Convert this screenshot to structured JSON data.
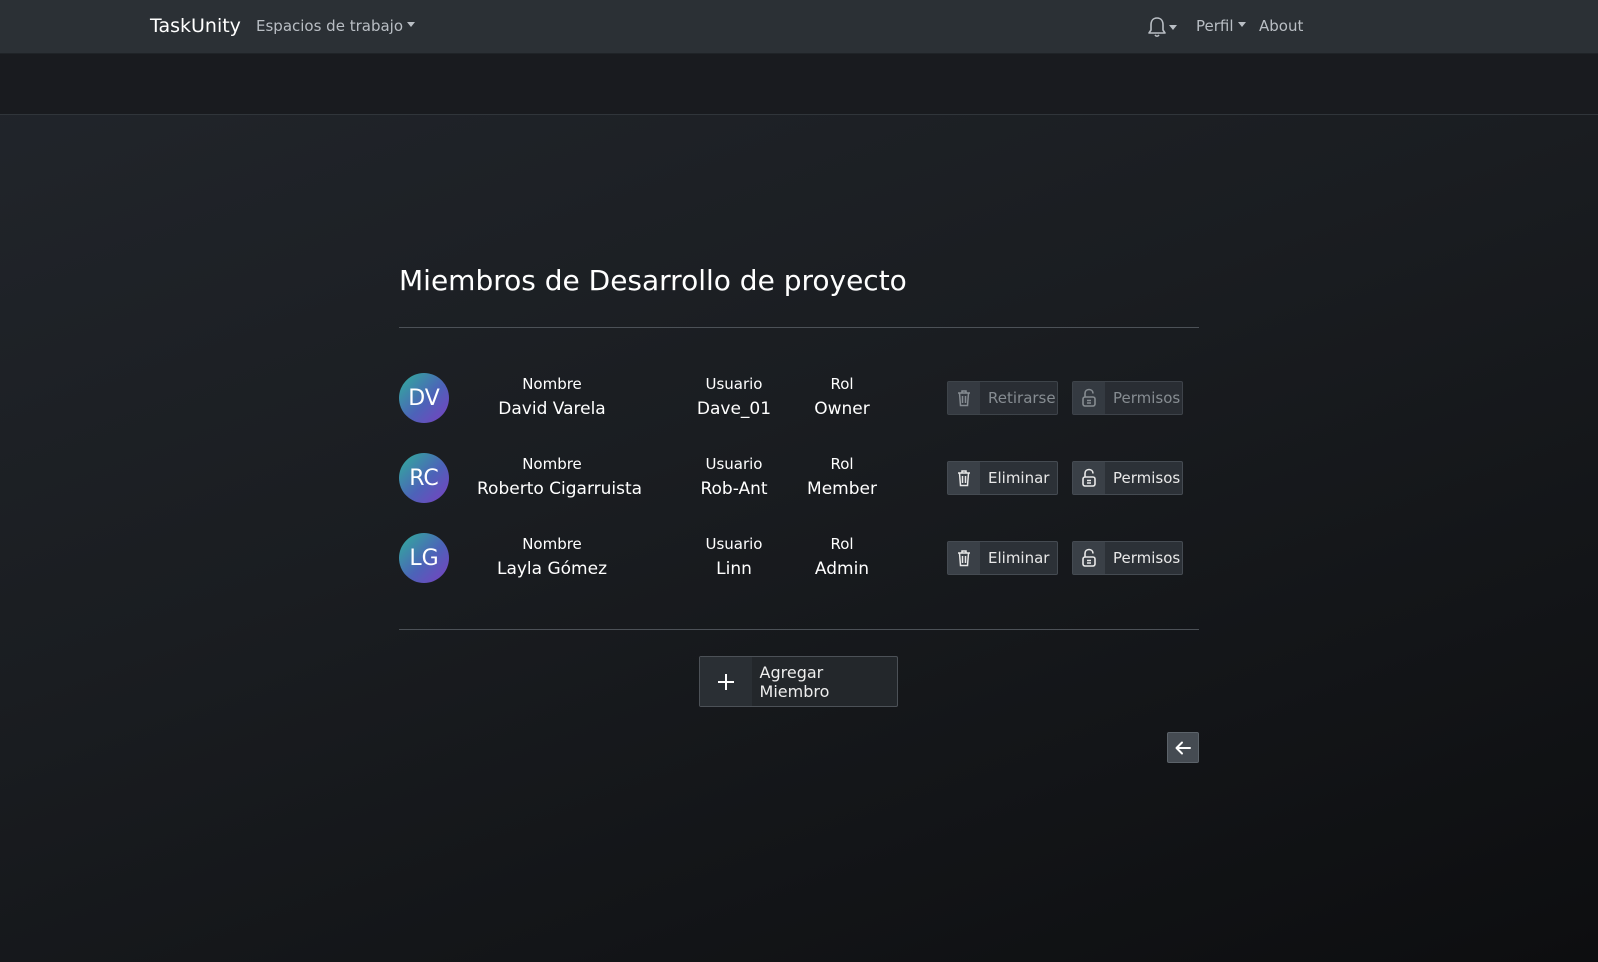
{
  "navbar": {
    "brand": "TaskUnity",
    "workspaces_label": "Espacios de trabajo",
    "notifications_icon": "bell-icon",
    "profile_label": "Perfil",
    "about_label": "About"
  },
  "page": {
    "title": "Miembros de Desarrollo de proyecto",
    "col_name": "Nombre",
    "col_user": "Usuario",
    "col_role": "Rol"
  },
  "members": [
    {
      "initials": "DV",
      "name": "David Varela",
      "username": "Dave_01",
      "role": "Owner",
      "remove_label": "Retirarse",
      "permissions_label": "Permisos",
      "buttons_disabled": true
    },
    {
      "initials": "RC",
      "name": "Roberto Cigarruista",
      "username": "Rob-Ant",
      "role": "Member",
      "remove_label": "Eliminar",
      "permissions_label": "Permisos",
      "buttons_disabled": false
    },
    {
      "initials": "LG",
      "name": "Layla Gómez",
      "username": "Linn",
      "role": "Admin",
      "remove_label": "Eliminar",
      "permissions_label": "Permisos",
      "buttons_disabled": false
    }
  ],
  "actions": {
    "add_member_label": "Agregar Miembro",
    "add_icon": "plus-icon",
    "back_icon": "arrow-left-icon",
    "remove_icon": "trash-icon",
    "permissions_icon": "unlock-icon"
  },
  "colors": {
    "navbar_bg": "#2b3035",
    "page_bg": "#1a1d21",
    "avatar_gradient_start": "#2fb29a",
    "avatar_gradient_end": "#7b3fc1"
  }
}
